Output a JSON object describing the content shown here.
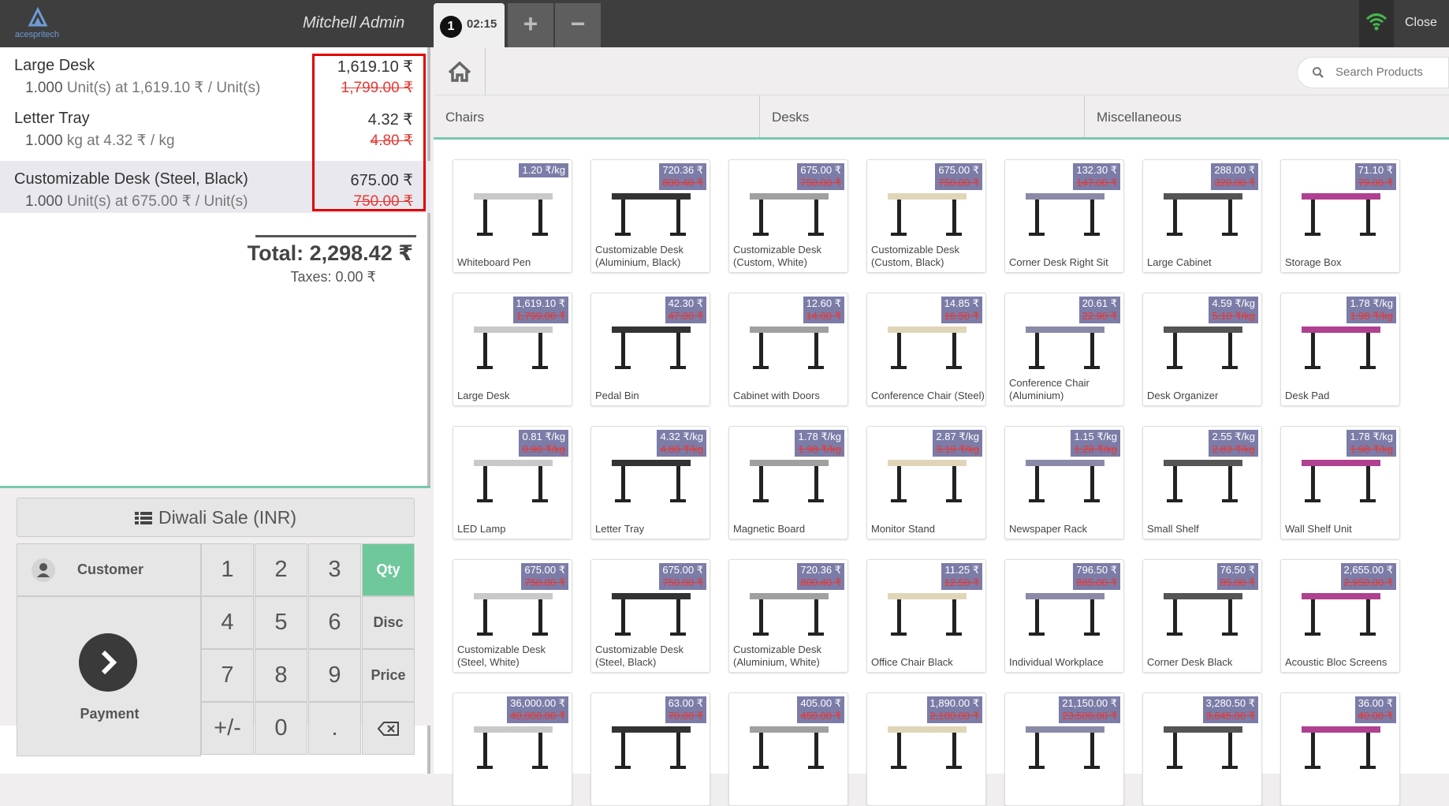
{
  "header": {
    "logo_text": "acespritech",
    "cashier": "Mitchell Admin",
    "order_number": "1",
    "order_time": "02:15",
    "add_label": "+",
    "remove_label": "−",
    "close_label": "Close"
  },
  "order": {
    "lines": [
      {
        "name": "Large Desk",
        "qty": "1.000",
        "unit_info": "Unit(s) at 1,619.10 ₹ / Unit(s)",
        "price": "1,619.10 ₹",
        "old_price": "1,799.00 ₹"
      },
      {
        "name": "Letter Tray",
        "qty": "1.000",
        "unit_info": "kg at 4.32 ₹ / kg",
        "price": "4.32 ₹",
        "old_price": "4.80 ₹"
      },
      {
        "name": "Customizable Desk (Steel, Black)",
        "qty": "1.000",
        "unit_info": "Unit(s) at 675.00 ₹ / Unit(s)",
        "price": "675.00 ₹",
        "old_price": "750.00 ₹"
      }
    ],
    "total": "Total: 2,298.42 ₹",
    "taxes": "Taxes: 0.00 ₹"
  },
  "controls": {
    "pricelist": "Diwali Sale (INR)",
    "customer": "Customer",
    "payment": "Payment",
    "keys": [
      "1",
      "2",
      "3",
      "Qty",
      "4",
      "5",
      "6",
      "Disc",
      "7",
      "8",
      "9",
      "Price",
      "+/-",
      "0",
      "."
    ]
  },
  "products_panel": {
    "search_placeholder": "Search Products",
    "categories": [
      "Chairs",
      "Desks",
      "Miscellaneous"
    ],
    "products": [
      {
        "name": "Whiteboard Pen",
        "price": "1.20 ₹/kg",
        "old": ""
      },
      {
        "name": "Customizable Desk (Aluminium, Black)",
        "price": "720.36 ₹",
        "old": "800.40 ₹"
      },
      {
        "name": "Customizable Desk (Custom, White)",
        "price": "675.00 ₹",
        "old": "750.00 ₹"
      },
      {
        "name": "Customizable Desk (Custom, Black)",
        "price": "675.00 ₹",
        "old": "750.00 ₹"
      },
      {
        "name": "Corner Desk Right Sit",
        "price": "132.30 ₹",
        "old": "147.00 ₹"
      },
      {
        "name": "Large Cabinet",
        "price": "288.00 ₹",
        "old": "320.00 ₹"
      },
      {
        "name": "Storage Box",
        "price": "71.10 ₹",
        "old": "79.00 ₹"
      },
      {
        "name": "Large Desk",
        "price": "1,619.10 ₹",
        "old": "1,799.00 ₹"
      },
      {
        "name": "Pedal Bin",
        "price": "42.30 ₹",
        "old": "47.00 ₹"
      },
      {
        "name": "Cabinet with Doors",
        "price": "12.60 ₹",
        "old": "14.00 ₹"
      },
      {
        "name": "Conference Chair (Steel)",
        "price": "14.85 ₹",
        "old": "16.50 ₹"
      },
      {
        "name": "Conference Chair (Aluminium)",
        "price": "20.61 ₹",
        "old": "22.90 ₹"
      },
      {
        "name": "Desk Organizer",
        "price": "4.59 ₹/kg",
        "old": "5.10 ₹/kg"
      },
      {
        "name": "Desk Pad",
        "price": "1.78 ₹/kg",
        "old": "1.98 ₹/kg"
      },
      {
        "name": "LED Lamp",
        "price": "0.81 ₹/kg",
        "old": "0.90 ₹/kg"
      },
      {
        "name": "Letter Tray",
        "price": "4.32 ₹/kg",
        "old": "4.80 ₹/kg"
      },
      {
        "name": "Magnetic Board",
        "price": "1.78 ₹/kg",
        "old": "1.98 ₹/kg"
      },
      {
        "name": "Monitor Stand",
        "price": "2.87 ₹/kg",
        "old": "3.19 ₹/kg"
      },
      {
        "name": "Newspaper Rack",
        "price": "1.15 ₹/kg",
        "old": "1.28 ₹/kg"
      },
      {
        "name": "Small Shelf",
        "price": "2.55 ₹/kg",
        "old": "2.83 ₹/kg"
      },
      {
        "name": "Wall Shelf Unit",
        "price": "1.78 ₹/kg",
        "old": "1.98 ₹/kg"
      },
      {
        "name": "Customizable Desk (Steel, White)",
        "price": "675.00 ₹",
        "old": "750.00 ₹"
      },
      {
        "name": "Customizable Desk (Steel, Black)",
        "price": "675.00 ₹",
        "old": "750.00 ₹"
      },
      {
        "name": "Customizable Desk (Aluminium, White)",
        "price": "720.36 ₹",
        "old": "800.40 ₹"
      },
      {
        "name": "Office Chair Black",
        "price": "11.25 ₹",
        "old": "12.50 ₹"
      },
      {
        "name": "Individual Workplace",
        "price": "796.50 ₹",
        "old": "885.00 ₹"
      },
      {
        "name": "Corner Desk Black",
        "price": "76.50 ₹",
        "old": "85.00 ₹"
      },
      {
        "name": "Acoustic Bloc Screens",
        "price": "2,655.00 ₹",
        "old": "2,950.00 ₹"
      },
      {
        "name": "",
        "price": "36,000.00 ₹",
        "old": "40,000.00 ₹"
      },
      {
        "name": "",
        "price": "63.00 ₹",
        "old": "70.00 ₹"
      },
      {
        "name": "",
        "price": "405.00 ₹",
        "old": "450.00 ₹"
      },
      {
        "name": "",
        "price": "1,890.00 ₹",
        "old": "2,100.00 ₹"
      },
      {
        "name": "",
        "price": "21,150.00 ₹",
        "old": "23,500.00 ₹"
      },
      {
        "name": "",
        "price": "3,280.50 ₹",
        "old": "3,645.00 ₹"
      },
      {
        "name": "",
        "price": "36.00 ₹",
        "old": "40.00 ₹"
      }
    ]
  },
  "colors": {
    "accent_green": "#6ec89b",
    "price_tag": "#7c7ca8",
    "strike_red": "#e53935",
    "highlight_box": "#e00000"
  }
}
